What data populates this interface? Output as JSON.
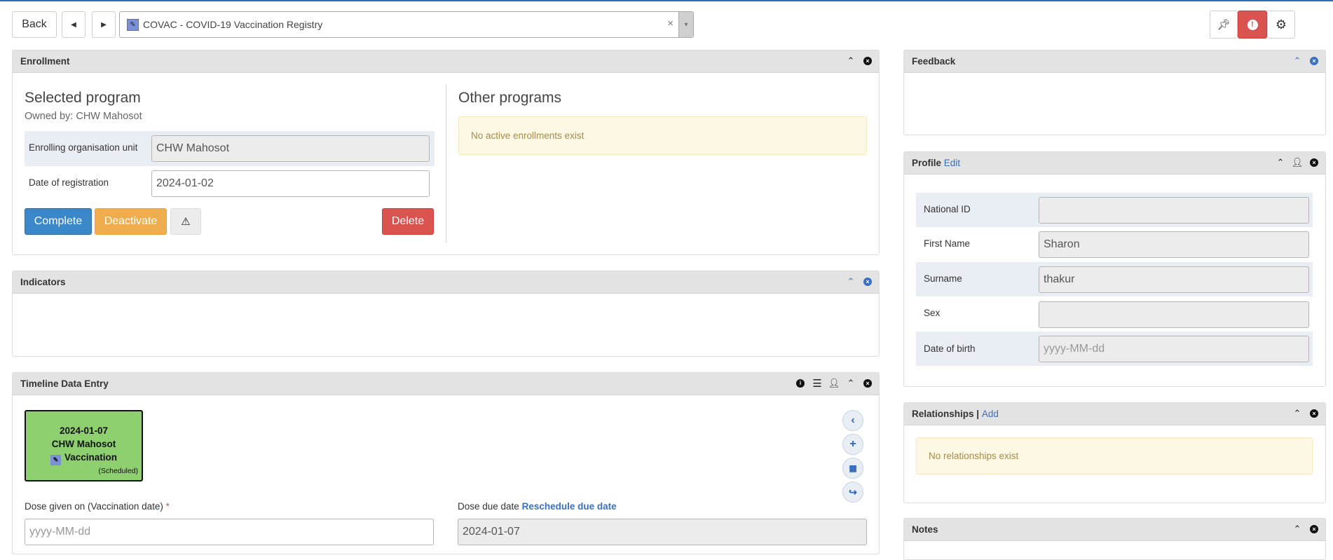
{
  "top_bar": {
    "back_label": "Back",
    "prev_icon": "caret-left-icon",
    "next_icon": "caret-right-icon",
    "program_select": "COVAC - COVID-19 Vaccination Registry",
    "clear_label": "×",
    "arrow_label": "▾",
    "pin_icon": "pin-icon",
    "alert_icon": "exclamation-circle-icon",
    "settings_icon": "gear-icon",
    "alert_color": "#d9534f"
  },
  "enrollment": {
    "title": "Enrollment",
    "selected_program_heading": "Selected program",
    "owned_by": "Owned by: CHW Mahosot",
    "org_unit_label": "Enrolling organisation unit",
    "org_unit_value": "CHW Mahosot",
    "registration_date_label": "Date of registration",
    "registration_date_value": "2024-01-02",
    "complete_label": "Complete",
    "deactivate_label": "Deactivate",
    "warning_label": "⚠",
    "delete_label": "Delete",
    "other_programs_heading": "Other programs",
    "no_enrollments": "No active enrollments exist",
    "colors": {
      "complete": "#3a87c9",
      "deactivate": "#efad4d",
      "delete": "#d9534f"
    }
  },
  "indicators": {
    "title": "Indicators"
  },
  "timeline": {
    "title": "Timeline Data Entry",
    "event": {
      "date": "2024-01-07",
      "org_unit": "CHW Mahosot",
      "stage": "Vaccination",
      "status": "(Scheduled)",
      "color": "#8ed06f"
    },
    "dose_given_label": "Dose given on (Vaccination date)",
    "required_mark": "*",
    "dose_given_placeholder": "yyyy-MM-dd",
    "dose_due_label": "Dose due date",
    "reschedule_label": "Reschedule due date",
    "dose_due_value": "2024-01-07"
  },
  "feedback": {
    "title": "Feedback"
  },
  "profile": {
    "title": "Profile",
    "edit_label": "Edit",
    "fields": [
      {
        "label": "National ID",
        "value": ""
      },
      {
        "label": "First Name",
        "value": "Sharon"
      },
      {
        "label": "Surname",
        "value": "thakur"
      },
      {
        "label": "Sex",
        "value": ""
      },
      {
        "label": "Date of birth",
        "value": "",
        "placeholder": "yyyy-MM-dd"
      }
    ]
  },
  "relationships": {
    "title": "Relationships",
    "separator": "|",
    "add_label": "Add",
    "empty": "No relationships exist"
  },
  "notes": {
    "title": "Notes"
  }
}
